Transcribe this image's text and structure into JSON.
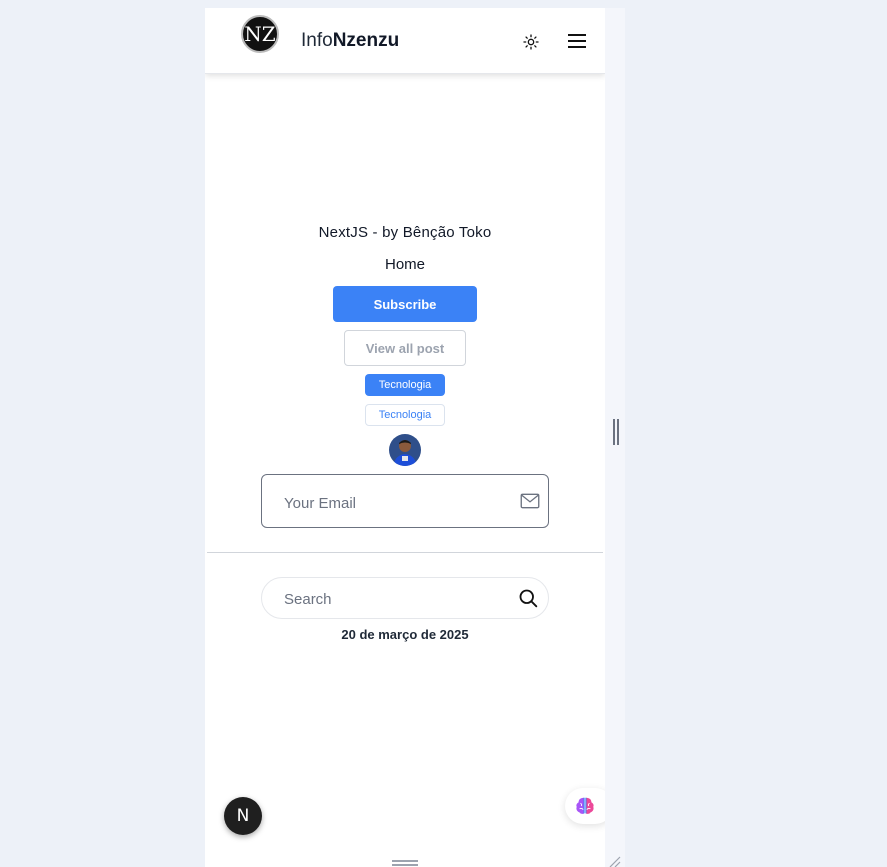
{
  "header": {
    "logo_text": "NZ",
    "brand_prefix": "Info",
    "brand_bold": "Nzenzu"
  },
  "main": {
    "site_title": "NextJS - by Bênção Toko",
    "home_label": "Home",
    "subscribe_label": "Subscribe",
    "view_all_label": "View all post",
    "tag_filled": "Tecnologia",
    "tag_outline": "Tecnologia",
    "email_placeholder": "Your Email",
    "search_placeholder": "Search",
    "date": "20 de março de 2025"
  },
  "floating": {
    "next_badge": "N"
  },
  "colors": {
    "accent": "#3b82f6",
    "background": "#edf1f8"
  },
  "icons": [
    "sun-icon",
    "hamburger-icon",
    "mail-icon",
    "search-icon",
    "brain-icon",
    "nextjs-icon"
  ]
}
